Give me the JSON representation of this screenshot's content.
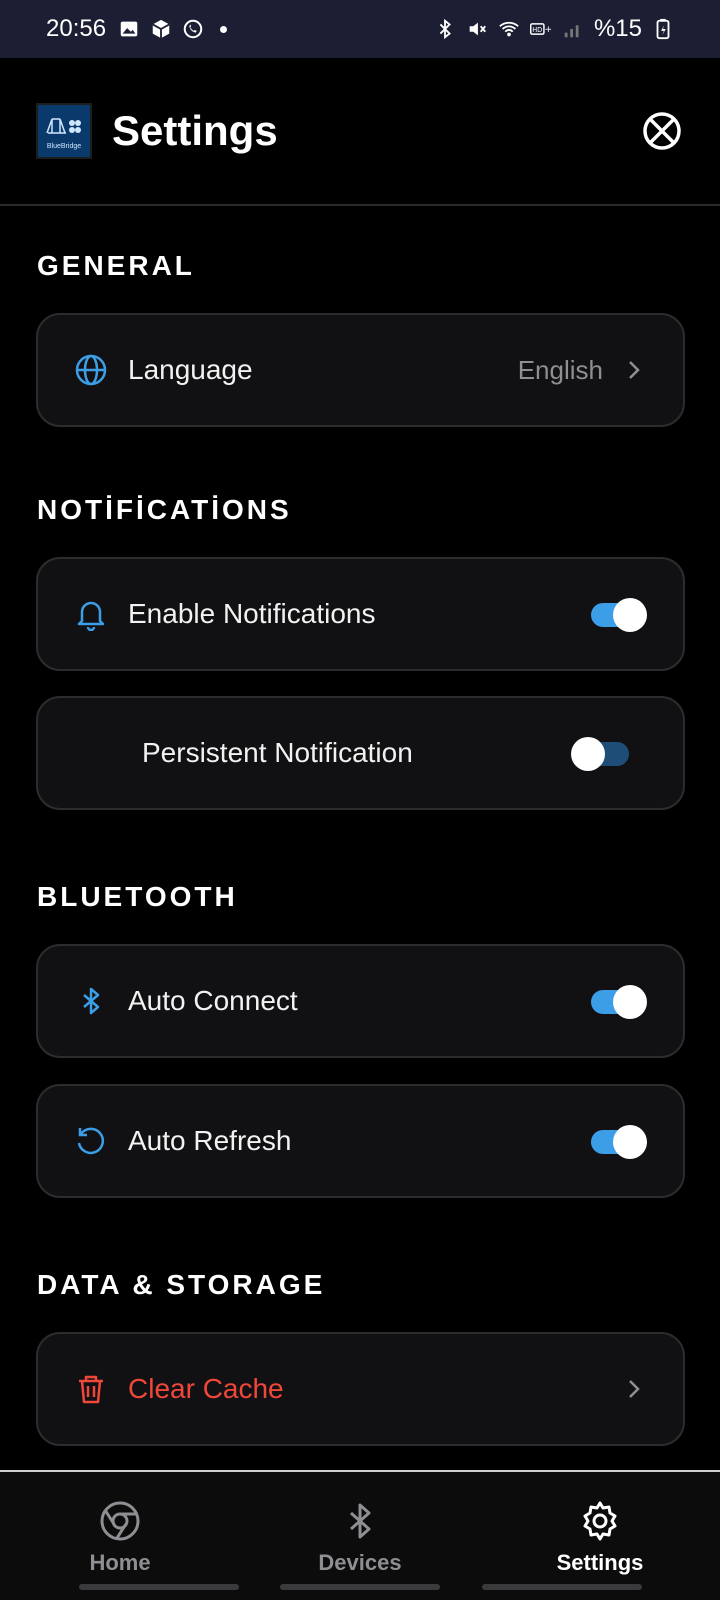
{
  "status_bar": {
    "time": "20:56",
    "battery": "%15",
    "icons_left": [
      "image-icon",
      "box-icon",
      "whatsapp-icon"
    ],
    "icons_right": [
      "bluetooth-icon",
      "mute-icon",
      "wifi-icon",
      "hd-signal-icon",
      "signal-icon",
      "battery-icon"
    ]
  },
  "header": {
    "logo_text": "BlueBridge",
    "title": "Settings",
    "action_icon": "disabled-circle-icon"
  },
  "sections": {
    "general": {
      "title": "GENERAL",
      "language": {
        "label": "Language",
        "value": "English",
        "icon": "globe-icon"
      }
    },
    "notifications": {
      "title": "NOTİFİCATİONS",
      "enable": {
        "label": "Enable Notifications",
        "icon": "bell-icon",
        "on": true
      },
      "persistent": {
        "label": "Persistent Notification",
        "on": false
      }
    },
    "bluetooth": {
      "title": "BLUETOOTH",
      "auto_connect": {
        "label": "Auto Connect",
        "icon": "bluetooth-icon",
        "on": true
      },
      "auto_refresh": {
        "label": "Auto Refresh",
        "icon": "refresh-icon",
        "on": true
      }
    },
    "data_storage": {
      "title": "DATA & STORAGE",
      "clear_cache": {
        "label": "Clear Cache",
        "icon": "trash-icon"
      }
    }
  },
  "bottom_nav": {
    "items": [
      {
        "label": "Home",
        "icon": "home-icon",
        "active": false
      },
      {
        "label": "Devices",
        "icon": "bluetooth-icon",
        "active": false
      },
      {
        "label": "Settings",
        "icon": "gear-icon",
        "active": true
      }
    ]
  },
  "colors": {
    "accent": "#3d9ee8",
    "danger": "#f0473b",
    "card_bg": "#111113",
    "status_bar_bg": "#1c1f33"
  }
}
